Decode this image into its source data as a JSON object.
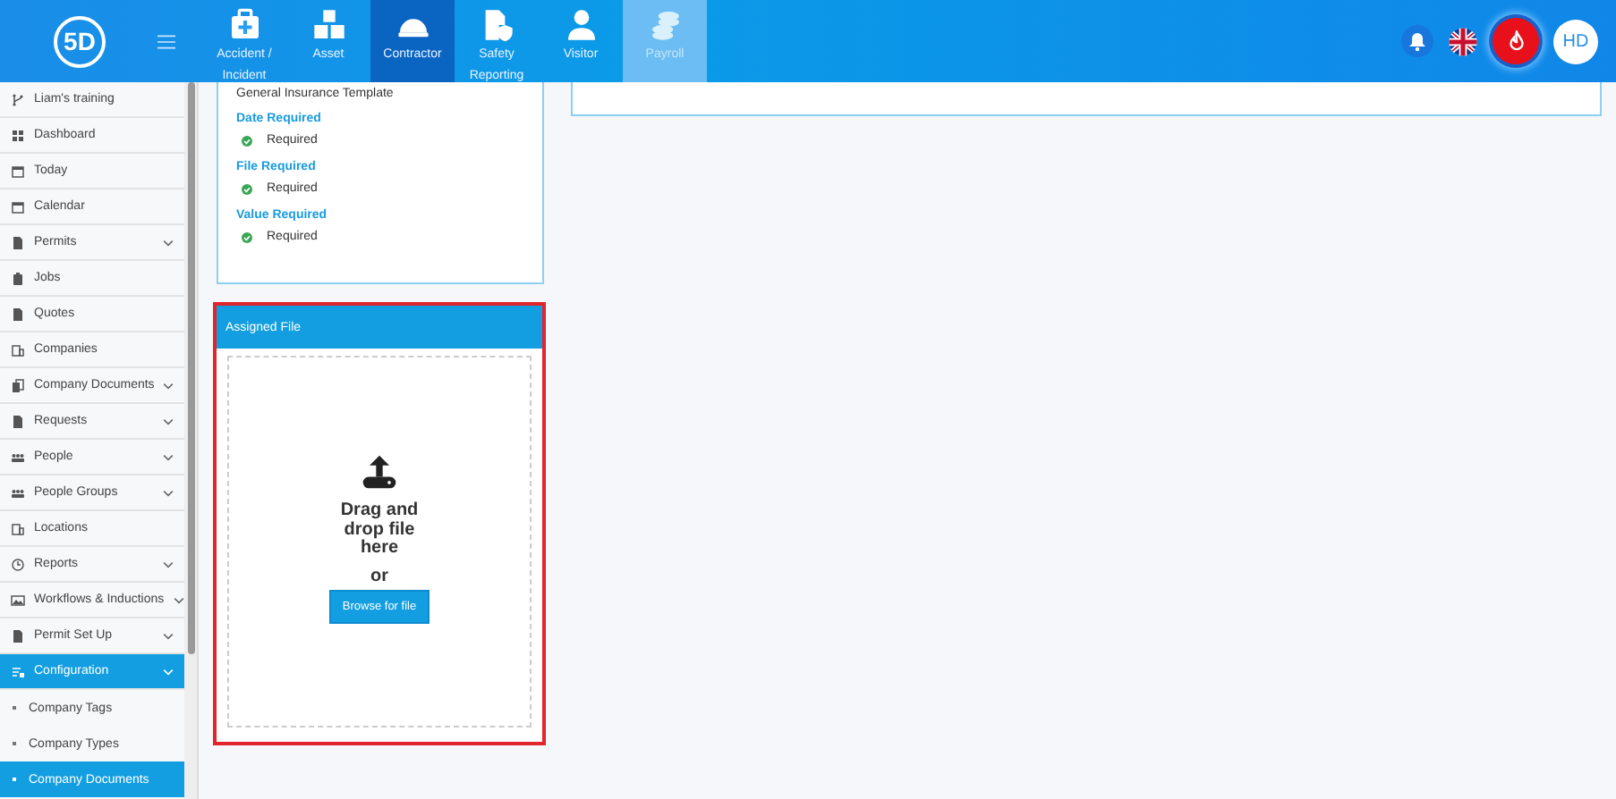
{
  "header": {
    "logo": "5D",
    "tabs": [
      {
        "label": "Accident / Incident",
        "selected": false,
        "disabled": false
      },
      {
        "label": "Asset",
        "selected": false,
        "disabled": false
      },
      {
        "label": "Contractor",
        "selected": true,
        "disabled": false
      },
      {
        "label": "Safety Reporting",
        "selected": false,
        "disabled": false
      },
      {
        "label": "Visitor",
        "selected": false,
        "disabled": false
      },
      {
        "label": "Payroll",
        "selected": false,
        "disabled": true
      }
    ],
    "avatar": "HD"
  },
  "sidebar": {
    "items": [
      {
        "label": "Liam's training",
        "expandable": false,
        "selected": false,
        "kind": "main"
      },
      {
        "label": "Dashboard",
        "expandable": false,
        "selected": false,
        "kind": "main"
      },
      {
        "label": "Today",
        "expandable": false,
        "selected": false,
        "kind": "main"
      },
      {
        "label": "Calendar",
        "expandable": false,
        "selected": false,
        "kind": "main"
      },
      {
        "label": "Permits",
        "expandable": true,
        "selected": false,
        "kind": "main"
      },
      {
        "label": "Jobs",
        "expandable": false,
        "selected": false,
        "kind": "main"
      },
      {
        "label": "Quotes",
        "expandable": false,
        "selected": false,
        "kind": "main"
      },
      {
        "label": "Companies",
        "expandable": false,
        "selected": false,
        "kind": "main"
      },
      {
        "label": "Company Documents",
        "expandable": true,
        "selected": false,
        "kind": "main"
      },
      {
        "label": "Requests",
        "expandable": true,
        "selected": false,
        "kind": "main"
      },
      {
        "label": "People",
        "expandable": true,
        "selected": false,
        "kind": "main"
      },
      {
        "label": "People Groups",
        "expandable": true,
        "selected": false,
        "kind": "main"
      },
      {
        "label": "Locations",
        "expandable": false,
        "selected": false,
        "kind": "main"
      },
      {
        "label": "Reports",
        "expandable": true,
        "selected": false,
        "kind": "main"
      },
      {
        "label": "Workflows & Inductions",
        "expandable": true,
        "selected": false,
        "kind": "main"
      },
      {
        "label": "Permit Set Up",
        "expandable": true,
        "selected": false,
        "kind": "main"
      },
      {
        "label": "Configuration",
        "expandable": true,
        "selected": true,
        "kind": "main"
      },
      {
        "label": "Company Tags",
        "expandable": false,
        "selected": false,
        "kind": "sub"
      },
      {
        "label": "Company Types",
        "expandable": false,
        "selected": false,
        "kind": "sub"
      },
      {
        "label": "Company Documents",
        "expandable": false,
        "selected": true,
        "kind": "sub"
      }
    ]
  },
  "template_card": {
    "name": "General Insurance Template",
    "requirements": [
      {
        "heading": "Date Required",
        "value": "Required",
        "met": true
      },
      {
        "heading": "File Required",
        "value": "Required",
        "met": true
      },
      {
        "heading": "Value Required",
        "value": "Required",
        "met": true
      }
    ]
  },
  "assigned_file": {
    "title": "Assigned File",
    "drop_text": "Drag and drop file here",
    "or": "or",
    "button": "Browse for file"
  }
}
